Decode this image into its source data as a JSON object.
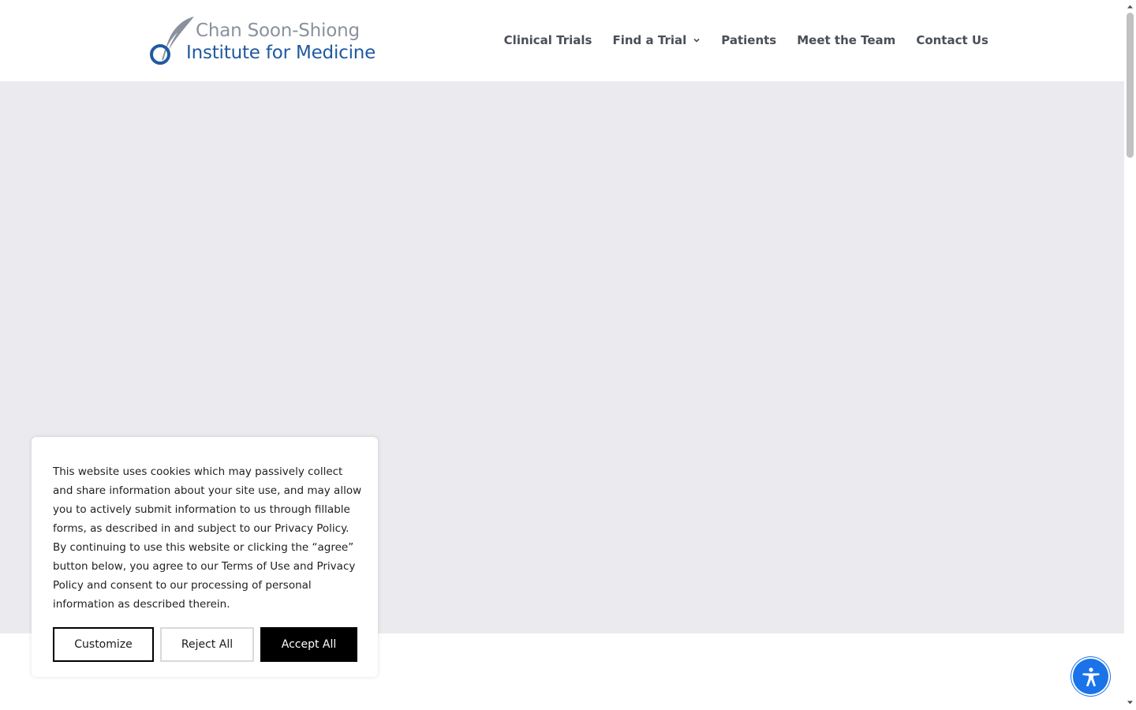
{
  "logo": {
    "line1": "Chan Soon-Shiong",
    "line2": "Institute for Medicine",
    "mark_icon": "quill-circle-logo-icon"
  },
  "nav": {
    "items": [
      {
        "label": "Clinical Trials"
      },
      {
        "label": "Find a Trial",
        "has_dropdown": true
      },
      {
        "label": "Patients"
      },
      {
        "label": "Meet the Team"
      },
      {
        "label": "Contact Us"
      }
    ]
  },
  "cookie_banner": {
    "text": "This website uses cookies which may passively collect and share information about your site use, and may allow you to actively submit information to us through fillable forms, as described in and subject to our Privacy Policy. By continuing to use this website or clicking the “agree” button below, you agree to our Terms of Use and Privacy Policy and consent to our processing of personal information as described therein.",
    "customize_label": "Customize",
    "reject_label": "Reject All",
    "accept_label": "Accept All"
  },
  "accessibility": {
    "icon": "accessibility-person-icon"
  },
  "colors": {
    "brand_blue": "#1f5aa0",
    "brand_gray": "#8a919c",
    "hero_bg": "#ebebef",
    "a11y_blue": "#1a73e8"
  }
}
